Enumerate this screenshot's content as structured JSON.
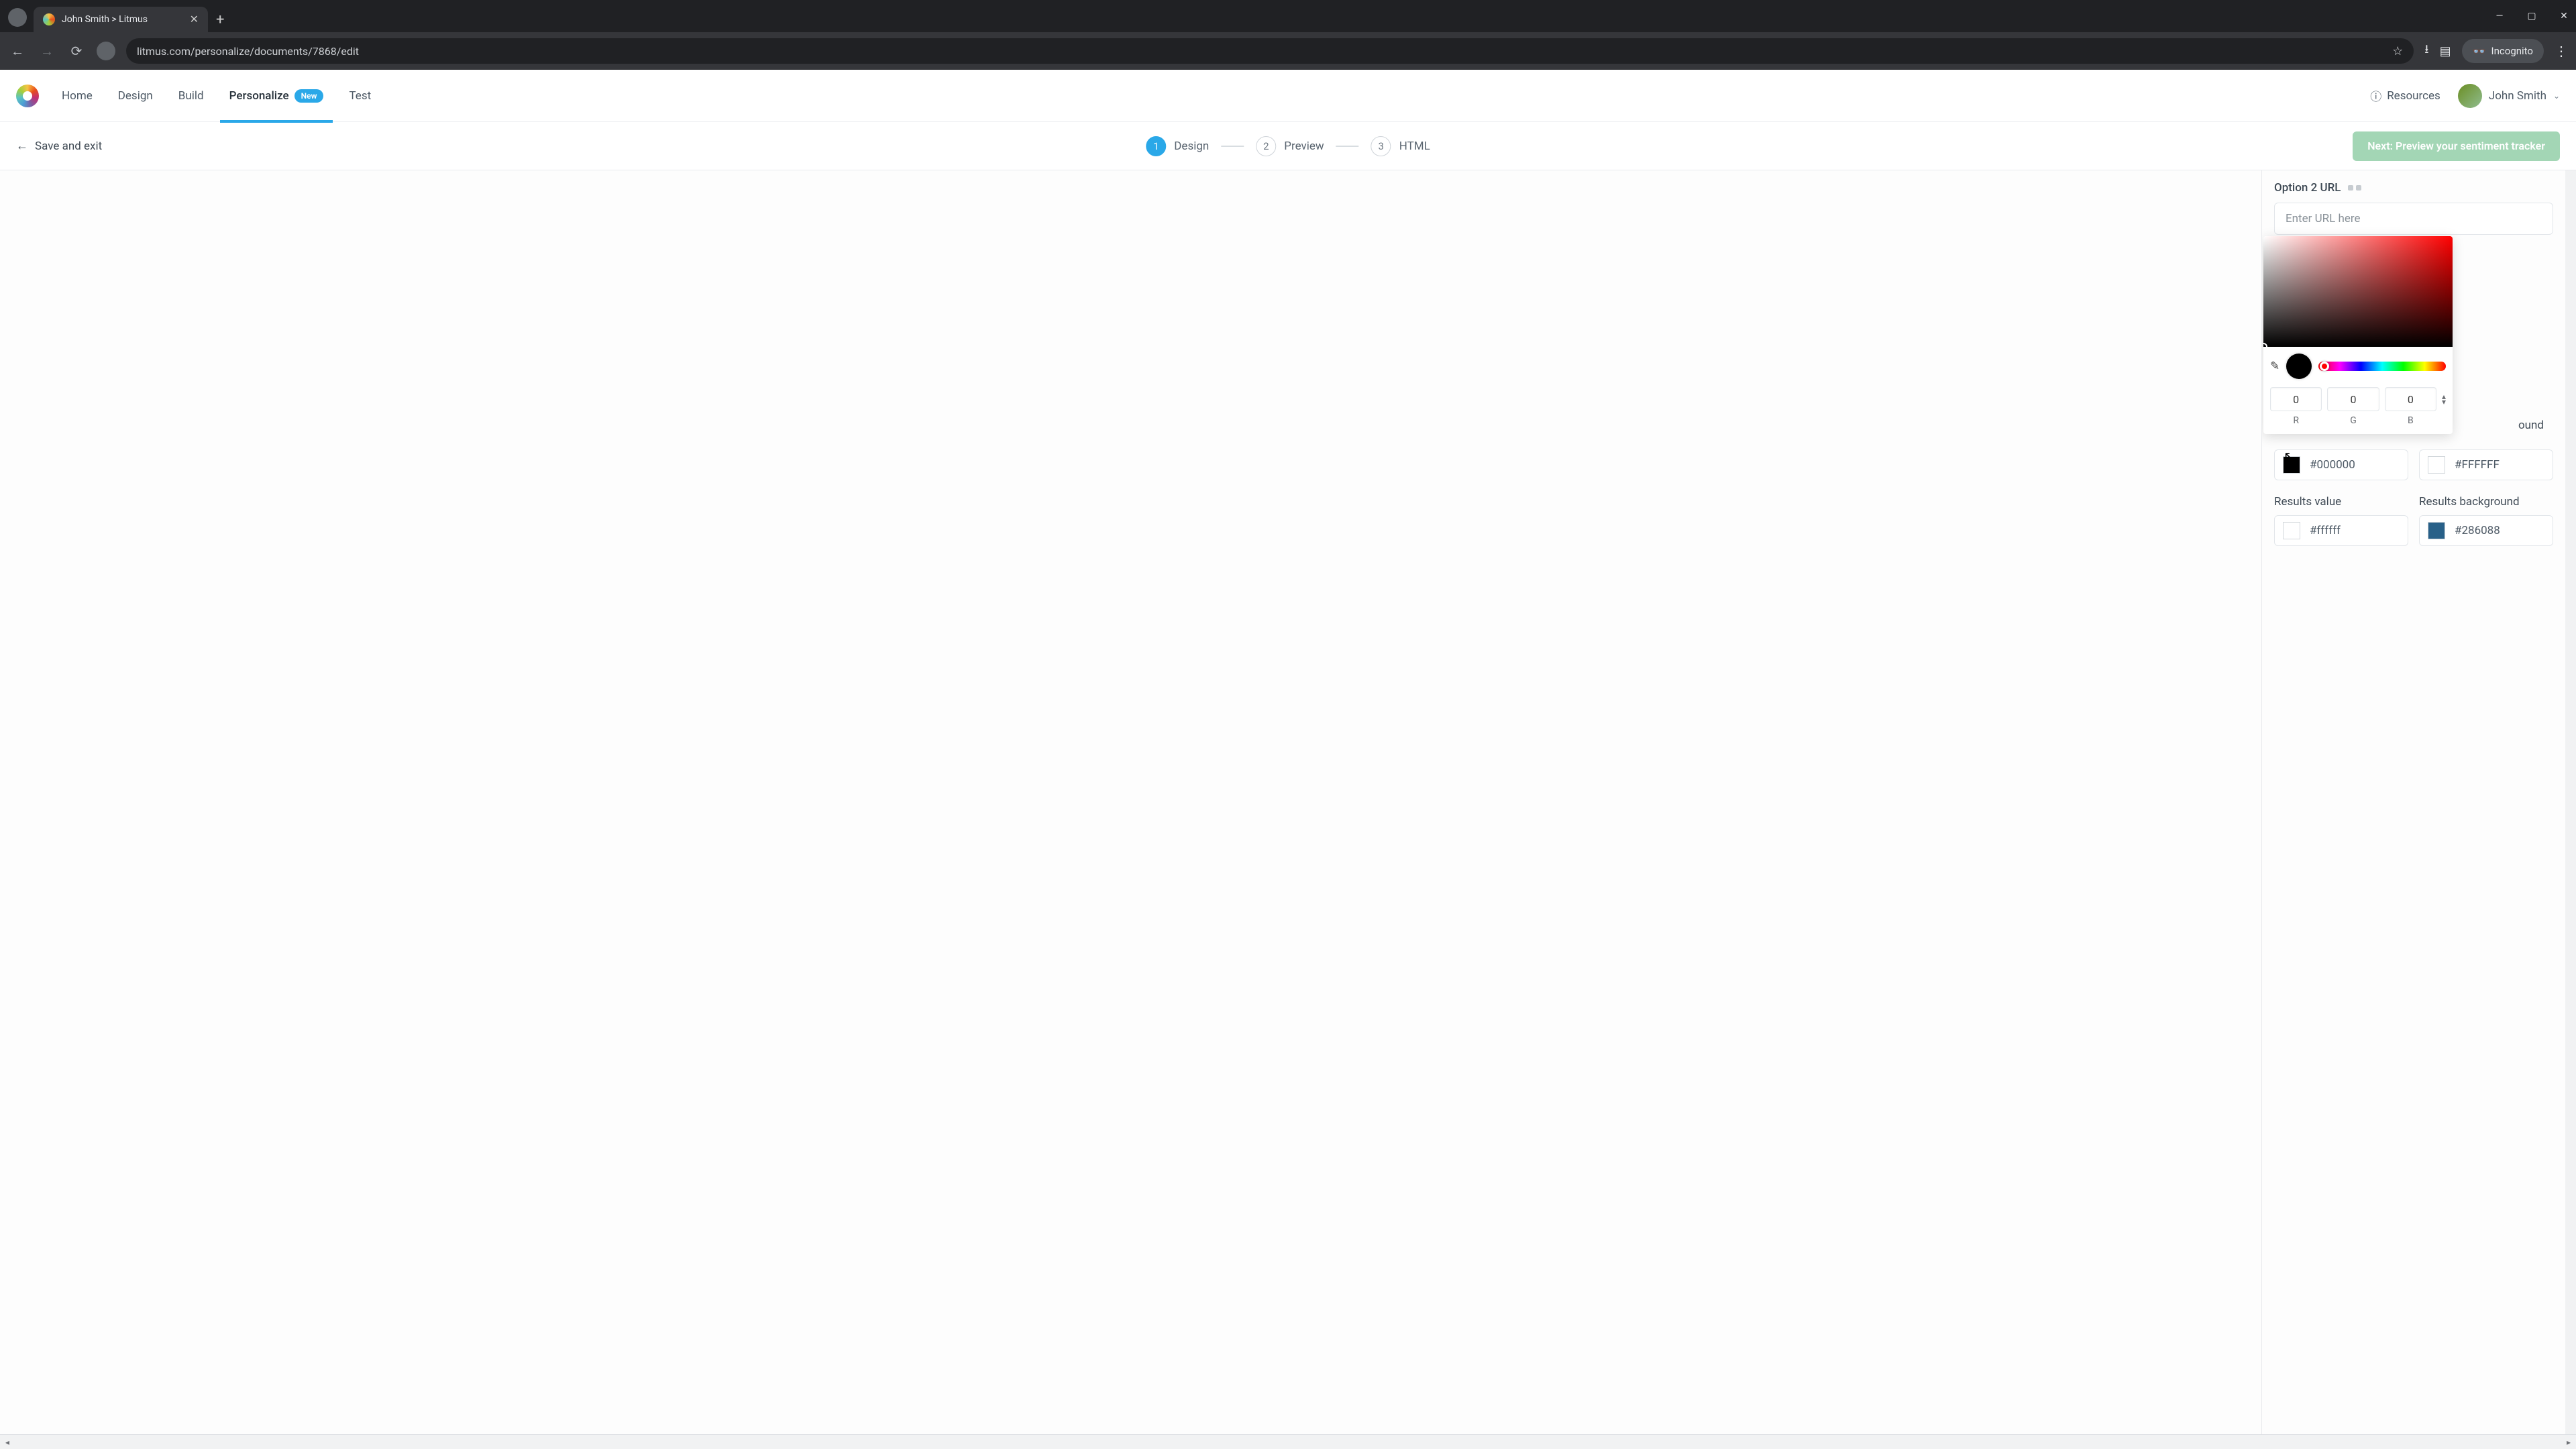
{
  "tab": {
    "title": "John Smith > Litmus"
  },
  "address": "litmus.com/personalize/documents/7868/edit",
  "incognito_label": "Incognito",
  "nav": {
    "home": "Home",
    "design": "Design",
    "build": "Build",
    "personalize": "Personalize",
    "new_badge": "New",
    "test": "Test"
  },
  "resources_label": "Resources",
  "user_name": "John Smith",
  "save_exit": "Save and exit",
  "steps": {
    "1": {
      "num": "1",
      "label": "Design"
    },
    "2": {
      "num": "2",
      "label": "Preview"
    },
    "3": {
      "num": "3",
      "label": "HTML"
    }
  },
  "cta": "Next: Preview your sentiment tracker",
  "panel": {
    "option2_url_label": "Option 2 URL",
    "url_placeholder": "Enter URL here",
    "fg_hex": "#000000",
    "bg_label_partial": "ound",
    "bg_hex": "#FFFFFF",
    "results_value_label": "Results value",
    "results_bg_label": "Results background",
    "results_value_hex": "#ffffff",
    "results_bg_hex": "#286088"
  },
  "picker": {
    "r": "0",
    "g": "0",
    "b": "0",
    "r_label": "R",
    "g_label": "G",
    "b_label": "B"
  },
  "colors": {
    "accent": "#2aa8e8",
    "cta_bg": "#a3d6b5",
    "results_bg_swatch": "#286088"
  }
}
